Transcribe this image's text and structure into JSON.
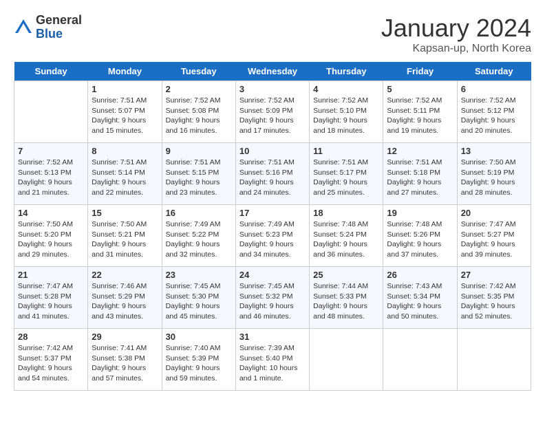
{
  "logo": {
    "general": "General",
    "blue": "Blue"
  },
  "title": "January 2024",
  "location": "Kapsan-up, North Korea",
  "headers": [
    "Sunday",
    "Monday",
    "Tuesday",
    "Wednesday",
    "Thursday",
    "Friday",
    "Saturday"
  ],
  "weeks": [
    [
      {
        "date": "",
        "sunrise": "",
        "sunset": "",
        "daylight": ""
      },
      {
        "date": "1",
        "sunrise": "Sunrise: 7:51 AM",
        "sunset": "Sunset: 5:07 PM",
        "daylight": "Daylight: 9 hours and 15 minutes."
      },
      {
        "date": "2",
        "sunrise": "Sunrise: 7:52 AM",
        "sunset": "Sunset: 5:08 PM",
        "daylight": "Daylight: 9 hours and 16 minutes."
      },
      {
        "date": "3",
        "sunrise": "Sunrise: 7:52 AM",
        "sunset": "Sunset: 5:09 PM",
        "daylight": "Daylight: 9 hours and 17 minutes."
      },
      {
        "date": "4",
        "sunrise": "Sunrise: 7:52 AM",
        "sunset": "Sunset: 5:10 PM",
        "daylight": "Daylight: 9 hours and 18 minutes."
      },
      {
        "date": "5",
        "sunrise": "Sunrise: 7:52 AM",
        "sunset": "Sunset: 5:11 PM",
        "daylight": "Daylight: 9 hours and 19 minutes."
      },
      {
        "date": "6",
        "sunrise": "Sunrise: 7:52 AM",
        "sunset": "Sunset: 5:12 PM",
        "daylight": "Daylight: 9 hours and 20 minutes."
      }
    ],
    [
      {
        "date": "7",
        "sunrise": "Sunrise: 7:52 AM",
        "sunset": "Sunset: 5:13 PM",
        "daylight": "Daylight: 9 hours and 21 minutes."
      },
      {
        "date": "8",
        "sunrise": "Sunrise: 7:51 AM",
        "sunset": "Sunset: 5:14 PM",
        "daylight": "Daylight: 9 hours and 22 minutes."
      },
      {
        "date": "9",
        "sunrise": "Sunrise: 7:51 AM",
        "sunset": "Sunset: 5:15 PM",
        "daylight": "Daylight: 9 hours and 23 minutes."
      },
      {
        "date": "10",
        "sunrise": "Sunrise: 7:51 AM",
        "sunset": "Sunset: 5:16 PM",
        "daylight": "Daylight: 9 hours and 24 minutes."
      },
      {
        "date": "11",
        "sunrise": "Sunrise: 7:51 AM",
        "sunset": "Sunset: 5:17 PM",
        "daylight": "Daylight: 9 hours and 25 minutes."
      },
      {
        "date": "12",
        "sunrise": "Sunrise: 7:51 AM",
        "sunset": "Sunset: 5:18 PM",
        "daylight": "Daylight: 9 hours and 27 minutes."
      },
      {
        "date": "13",
        "sunrise": "Sunrise: 7:50 AM",
        "sunset": "Sunset: 5:19 PM",
        "daylight": "Daylight: 9 hours and 28 minutes."
      }
    ],
    [
      {
        "date": "14",
        "sunrise": "Sunrise: 7:50 AM",
        "sunset": "Sunset: 5:20 PM",
        "daylight": "Daylight: 9 hours and 29 minutes."
      },
      {
        "date": "15",
        "sunrise": "Sunrise: 7:50 AM",
        "sunset": "Sunset: 5:21 PM",
        "daylight": "Daylight: 9 hours and 31 minutes."
      },
      {
        "date": "16",
        "sunrise": "Sunrise: 7:49 AM",
        "sunset": "Sunset: 5:22 PM",
        "daylight": "Daylight: 9 hours and 32 minutes."
      },
      {
        "date": "17",
        "sunrise": "Sunrise: 7:49 AM",
        "sunset": "Sunset: 5:23 PM",
        "daylight": "Daylight: 9 hours and 34 minutes."
      },
      {
        "date": "18",
        "sunrise": "Sunrise: 7:48 AM",
        "sunset": "Sunset: 5:24 PM",
        "daylight": "Daylight: 9 hours and 36 minutes."
      },
      {
        "date": "19",
        "sunrise": "Sunrise: 7:48 AM",
        "sunset": "Sunset: 5:26 PM",
        "daylight": "Daylight: 9 hours and 37 minutes."
      },
      {
        "date": "20",
        "sunrise": "Sunrise: 7:47 AM",
        "sunset": "Sunset: 5:27 PM",
        "daylight": "Daylight: 9 hours and 39 minutes."
      }
    ],
    [
      {
        "date": "21",
        "sunrise": "Sunrise: 7:47 AM",
        "sunset": "Sunset: 5:28 PM",
        "daylight": "Daylight: 9 hours and 41 minutes."
      },
      {
        "date": "22",
        "sunrise": "Sunrise: 7:46 AM",
        "sunset": "Sunset: 5:29 PM",
        "daylight": "Daylight: 9 hours and 43 minutes."
      },
      {
        "date": "23",
        "sunrise": "Sunrise: 7:45 AM",
        "sunset": "Sunset: 5:30 PM",
        "daylight": "Daylight: 9 hours and 45 minutes."
      },
      {
        "date": "24",
        "sunrise": "Sunrise: 7:45 AM",
        "sunset": "Sunset: 5:32 PM",
        "daylight": "Daylight: 9 hours and 46 minutes."
      },
      {
        "date": "25",
        "sunrise": "Sunrise: 7:44 AM",
        "sunset": "Sunset: 5:33 PM",
        "daylight": "Daylight: 9 hours and 48 minutes."
      },
      {
        "date": "26",
        "sunrise": "Sunrise: 7:43 AM",
        "sunset": "Sunset: 5:34 PM",
        "daylight": "Daylight: 9 hours and 50 minutes."
      },
      {
        "date": "27",
        "sunrise": "Sunrise: 7:42 AM",
        "sunset": "Sunset: 5:35 PM",
        "daylight": "Daylight: 9 hours and 52 minutes."
      }
    ],
    [
      {
        "date": "28",
        "sunrise": "Sunrise: 7:42 AM",
        "sunset": "Sunset: 5:37 PM",
        "daylight": "Daylight: 9 hours and 54 minutes."
      },
      {
        "date": "29",
        "sunrise": "Sunrise: 7:41 AM",
        "sunset": "Sunset: 5:38 PM",
        "daylight": "Daylight: 9 hours and 57 minutes."
      },
      {
        "date": "30",
        "sunrise": "Sunrise: 7:40 AM",
        "sunset": "Sunset: 5:39 PM",
        "daylight": "Daylight: 9 hours and 59 minutes."
      },
      {
        "date": "31",
        "sunrise": "Sunrise: 7:39 AM",
        "sunset": "Sunset: 5:40 PM",
        "daylight": "Daylight: 10 hours and 1 minute."
      },
      {
        "date": "",
        "sunrise": "",
        "sunset": "",
        "daylight": ""
      },
      {
        "date": "",
        "sunrise": "",
        "sunset": "",
        "daylight": ""
      },
      {
        "date": "",
        "sunrise": "",
        "sunset": "",
        "daylight": ""
      }
    ]
  ]
}
